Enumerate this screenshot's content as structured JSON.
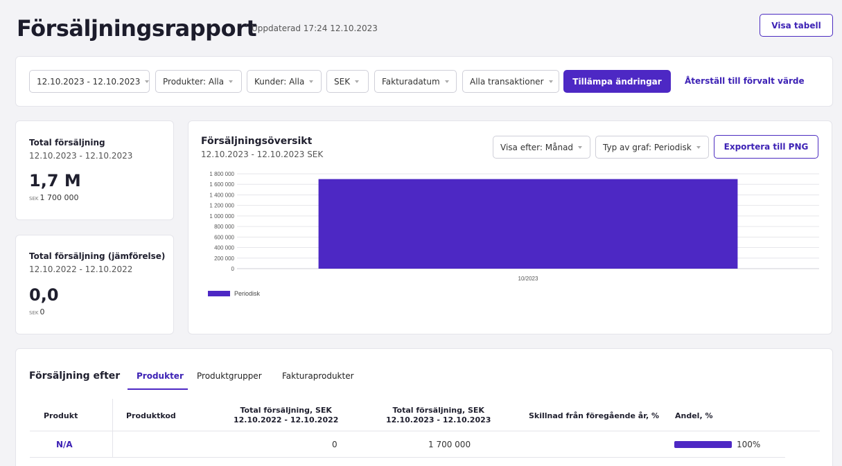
{
  "header": {
    "title": "Försäljningsrapport",
    "updated": "Uppdaterad 17:24 12.10.2023",
    "view_table_label": "Visa tabell"
  },
  "filters": {
    "date_range": "12.10.2023 - 12.10.2023",
    "products": "Produkter: Alla",
    "customers": "Kunder: Alla",
    "currency": "SEK",
    "date_type": "Fakturadatum",
    "transactions": "Alla transaktioner",
    "apply_label": "Tillämpa ändringar",
    "reset_label": "Återställ till förvalt värde"
  },
  "stats": {
    "total": {
      "label": "Total försäljning",
      "range": "12.10.2023 - 12.10.2023",
      "big": "1,7 M",
      "currency": "SEK",
      "exact": "1 700 000"
    },
    "comparison": {
      "label": "Total försäljning (jämförelse)",
      "range": "12.10.2022 - 12.10.2022",
      "big": "0,0",
      "currency": "SEK",
      "exact": "0"
    }
  },
  "overview": {
    "title": "Försäljningsöversikt",
    "subtitle": "12.10.2023 - 12.10.2023 SEK",
    "view_by": "Visa efter: Månad",
    "graph_type": "Typ av graf: Periodisk",
    "export_label": "Exportera till PNG"
  },
  "chart_data": {
    "type": "bar",
    "categories": [
      "10/2023"
    ],
    "series": [
      {
        "name": "Periodisk",
        "values": [
          1700000
        ]
      }
    ],
    "ylim": [
      0,
      1800000
    ],
    "yticks": [
      0,
      200000,
      400000,
      600000,
      800000,
      1000000,
      1200000,
      1400000,
      1600000,
      1800000
    ],
    "ytick_labels": [
      "0",
      "200 000",
      "400 000",
      "600 000",
      "800 000",
      "1 000 000",
      "1 200 000",
      "1 400 000",
      "1 600 000",
      "1 800 000"
    ],
    "grid": true,
    "legend": "bottom-left",
    "bar_color": "#4d28c4"
  },
  "breakdown": {
    "title": "Försäljning efter",
    "tabs": [
      {
        "label": "Produkter",
        "active": true
      },
      {
        "label": "Produktgrupper",
        "active": false
      },
      {
        "label": "Fakturaprodukter",
        "active": false
      }
    ],
    "columns": {
      "product": "Produkt",
      "code": "Produktkod",
      "prev_title": "Total försäljning, SEK",
      "prev_range": "12.10.2022 - 12.10.2022",
      "curr_title": "Total försäljning, SEK",
      "curr_range": "12.10.2023 - 12.10.2023",
      "diff": "Skillnad från föregående år, %",
      "share": "Andel, %"
    },
    "rows": [
      {
        "product": "N/A",
        "code": "",
        "prev": "0",
        "curr": "1 700 000",
        "diff": "",
        "share": "100%",
        "share_value": 100
      }
    ]
  },
  "colors": {
    "accent": "#4d28c4",
    "link": "#3d22b5"
  }
}
